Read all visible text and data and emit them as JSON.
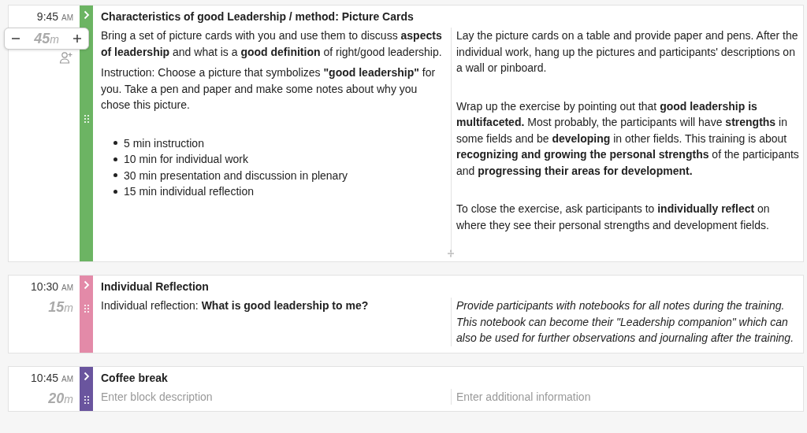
{
  "blocks": [
    {
      "time": "9:45",
      "period": "AM",
      "duration": "45",
      "unit": "m",
      "editing": true,
      "color": "#6cb463",
      "title": "Characteristics of good Leadership / method: Picture Cards",
      "description": [
        {
          "kind": "text",
          "text": "Bring a set of picture cards with you and use them to discuss **aspects of leadership** and what is a **good definition** of right/good leadership."
        },
        {
          "kind": "text",
          "text": "Instruction: Choose a picture that symbolizes **\"good leadership\"** for you. Take a pen and paper and make some notes about why you chose this picture."
        },
        {
          "kind": "list",
          "items": [
            "5 min instruction",
            "10 min for individual work",
            "30 min presentation and discussion in plenary",
            "15 min individual reflection"
          ]
        }
      ],
      "notes": [
        {
          "kind": "text",
          "text": "Lay the picture cards on a table and provide paper and pens. After the individual work, hang up the pictures and participants' descriptions on a wall or pinboard."
        },
        {
          "kind": "text",
          "text": "Wrap up the exercise by pointing out that **good leadership is multifaceted.** Most probably, the participants will have **strengths** in some fields and be **developing** in other fields. This training is about **recognizing and growing the personal strengths** of the participants and **progressing their areas for development.**"
        },
        {
          "kind": "text",
          "text": "To close the exercise, ask participants to **individually reflect** on where they see their personal strengths and development fields."
        }
      ]
    },
    {
      "time": "10:30",
      "period": "AM",
      "duration": "15",
      "unit": "m",
      "editing": false,
      "color": "#e38aa8",
      "title": "Individual Reflection",
      "description": [
        {
          "kind": "text",
          "text": "Individual reflection: **What is good leadership to me?**"
        }
      ],
      "notes": [
        {
          "kind": "italic",
          "text": "Provide participants with notebooks for all notes during the training. This notebook can become their \"Leadership companion\" which can also be used for further observations and journaling after the training."
        }
      ]
    },
    {
      "time": "10:45",
      "period": "AM",
      "duration": "20",
      "unit": "m",
      "editing": false,
      "color": "#6a559e",
      "title": "Coffee break",
      "description_placeholder": "Enter block description",
      "notes_placeholder": "Enter additional information"
    }
  ]
}
